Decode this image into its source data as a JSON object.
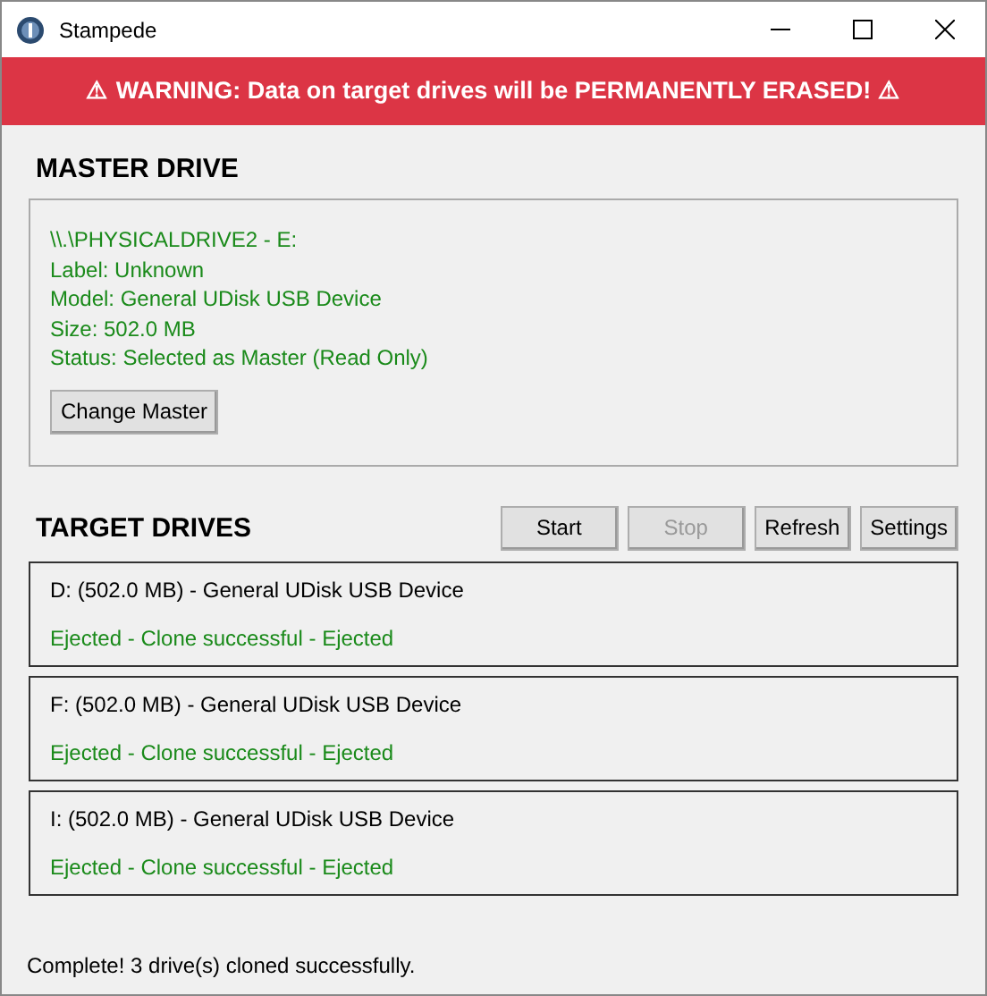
{
  "window": {
    "title": "Stampede"
  },
  "warning": "⚠ WARNING: Data on target drives will be PERMANENTLY ERASED! ⚠",
  "master": {
    "heading": "MASTER DRIVE",
    "lines": [
      "\\\\.\\PHYSICALDRIVE2 - E:",
      "Label: Unknown",
      "Model: General UDisk USB Device",
      "Size: 502.0 MB",
      "Status: Selected as Master (Read Only)"
    ],
    "button": "Change Master"
  },
  "targets": {
    "heading": "TARGET DRIVES",
    "buttons": [
      {
        "label": "Start",
        "disabled": false
      },
      {
        "label": "Stop",
        "disabled": true
      },
      {
        "label": "Refresh",
        "disabled": false
      },
      {
        "label": "Settings",
        "disabled": false
      }
    ],
    "drives": [
      {
        "name": "D: (502.0 MB) - General UDisk USB Device",
        "status": "Ejected - Clone successful - Ejected"
      },
      {
        "name": "F: (502.0 MB) - General UDisk USB Device",
        "status": "Ejected - Clone successful - Ejected"
      },
      {
        "name": "I: (502.0 MB) - General UDisk USB Device",
        "status": "Ejected - Clone successful - Ejected"
      }
    ]
  },
  "status_bar": "Complete! 3 drive(s) cloned successfully."
}
